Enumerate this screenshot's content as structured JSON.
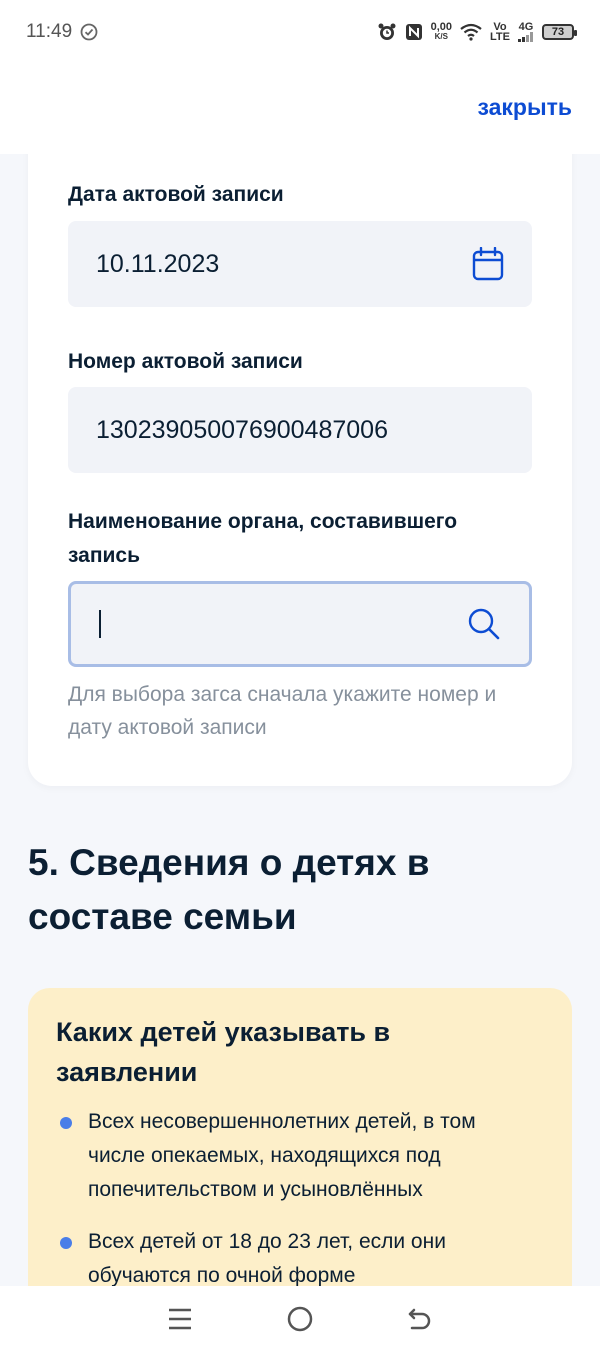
{
  "status_bar": {
    "time": "11:49",
    "net_speed_value": "0,00",
    "net_speed_unit": "K/S",
    "volte_top": "Vo",
    "volte_bottom": "LTE",
    "network": "4G",
    "battery": "73"
  },
  "header": {
    "close_label": "закрыть"
  },
  "form": {
    "act_date": {
      "label": "Дата актовой записи",
      "value": "10.11.2023",
      "icon": "calendar-icon"
    },
    "act_number": {
      "label": "Номер актовой записи",
      "value": "130239050076900487006"
    },
    "registry_office": {
      "label": "Наименование органа, составившего запись",
      "value": "",
      "icon": "search-icon",
      "hint": "Для выбора загса сначала укажите номер и дату актовой записи"
    }
  },
  "section": {
    "title": "5. Сведения о детях в составе семьи"
  },
  "info": {
    "title": "Каких детей указывать в заявлении",
    "items": [
      "Всех несовершеннолетних детей, в том числе опекаемых, находящихся под попечительством и усыновлённых",
      "Всех детей от 18 до 23 лет, если они обучаются по очной форме"
    ]
  },
  "colors": {
    "accent": "#0d4cd3",
    "info_bg": "#fdefc9",
    "field_bg": "#f1f3f8",
    "bullet": "#4a7ee8"
  }
}
